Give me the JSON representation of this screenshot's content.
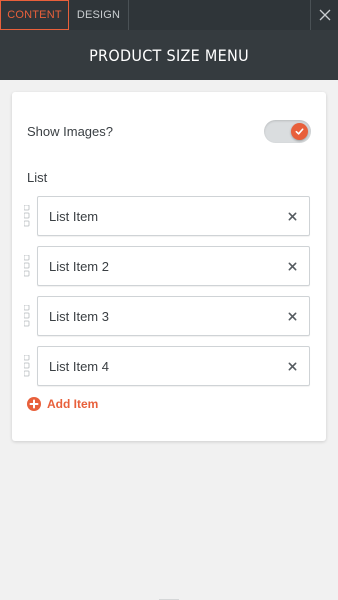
{
  "tabs": {
    "content_label": "CONTENT",
    "design_label": "DESIGN"
  },
  "header": {
    "title": "PRODUCT SIZE MENU"
  },
  "settings": {
    "show_images_label": "Show Images?",
    "show_images_enabled": true,
    "list_label": "List"
  },
  "list_items": [
    {
      "label": "List Item"
    },
    {
      "label": "List Item 2"
    },
    {
      "label": "List Item 3"
    },
    {
      "label": "List Item 4"
    }
  ],
  "actions": {
    "add_item_label": "Add Item"
  },
  "colors": {
    "accent": "#e8603b",
    "toolbar_bg": "#2f3539",
    "header_bg": "#353b3f",
    "page_bg": "#f1f1f1"
  }
}
